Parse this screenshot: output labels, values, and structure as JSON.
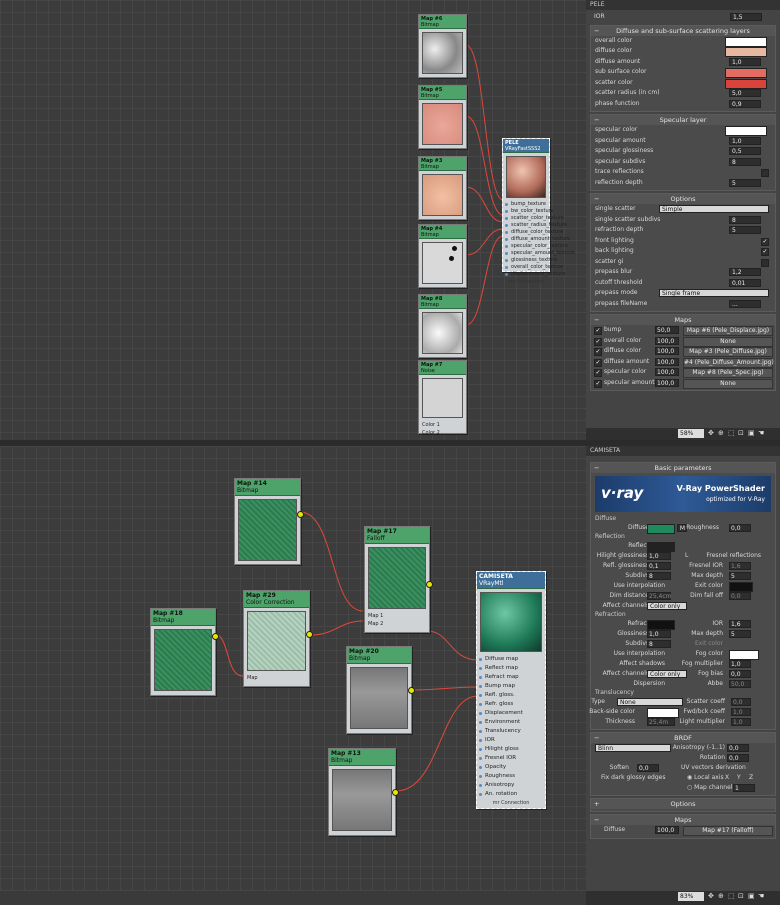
{
  "top_nodes": {
    "map6": {
      "title": "Map #6",
      "type": "Bitmap"
    },
    "map5": {
      "title": "Map #5",
      "type": "Bitmap"
    },
    "map3": {
      "title": "Map #3",
      "type": "Bitmap"
    },
    "map4": {
      "title": "Map #4",
      "type": "Bitmap"
    },
    "map8": {
      "title": "Map #8",
      "type": "Bitmap"
    },
    "map7": {
      "title": "Map #7",
      "type": "Noise",
      "slots": [
        "Color 1",
        "Color 2"
      ]
    },
    "pele": {
      "title": "PELE",
      "type": "VRayFastSSS2",
      "inputs": [
        "bump_texture",
        "bw_color_texture",
        "scatter_color_texture",
        "scatter_radius_texture",
        "diffuse_color_texture",
        "diffuse_amount_texture",
        "specular_color_texture",
        "specular_amount_texture",
        "glossiness_texture",
        "overall_color_texture",
        "displacement_texture"
      ],
      "footer": "mr Connection"
    }
  },
  "bottom_nodes": {
    "map14": {
      "title": "Map #14",
      "type": "Bitmap"
    },
    "map17": {
      "title": "Map #17",
      "type": "Falloff",
      "slots": [
        "Map 1",
        "Map 2"
      ]
    },
    "map29": {
      "title": "Map #29",
      "type": "Color Correction",
      "slots": [
        "Map"
      ]
    },
    "map18": {
      "title": "Map #18",
      "type": "Bitmap"
    },
    "map20": {
      "title": "Map #20",
      "type": "Bitmap"
    },
    "map13": {
      "title": "Map #13",
      "type": "Bitmap"
    },
    "camiseta": {
      "title": "CAMISETA",
      "type": "VRayMtl",
      "inputs": [
        "Diffuse map",
        "Reflect map",
        "Refract map",
        "Bump map",
        "Refl. gloss.",
        "Refr. gloss",
        "Displacement",
        "Environment",
        "Translucency",
        "IOR",
        "Hilight gloss",
        "Fresnel IOR",
        "Opacity",
        "Roughness",
        "Anisotropy",
        "An. rotation"
      ],
      "footer": "mr Connection"
    }
  },
  "top_panel": {
    "header": "PELE",
    "ior_label": "IOR",
    "ior_value": "1,5",
    "diffuse_group": {
      "title": "Diffuse and sub-surface scattering layers",
      "rows": [
        {
          "label": "overall color",
          "kind": "color",
          "color": "#ffffff"
        },
        {
          "label": "diffuse color",
          "kind": "color",
          "color": "#e7b8a0"
        },
        {
          "label": "diffuse amount",
          "kind": "value",
          "value": "1,0"
        },
        {
          "label": "sub surface color",
          "kind": "color",
          "color": "#e26b62"
        },
        {
          "label": "scatter color",
          "kind": "color",
          "color": "#d9433c"
        },
        {
          "label": "scatter radius (in cm)",
          "kind": "value",
          "value": "5,0"
        },
        {
          "label": "phase function",
          "kind": "value",
          "value": "0,9"
        }
      ]
    },
    "specular_group": {
      "title": "Specular layer",
      "rows": [
        {
          "label": "specular color",
          "kind": "color",
          "color": "#ffffff"
        },
        {
          "label": "specular amount",
          "kind": "value",
          "value": "1,0"
        },
        {
          "label": "specular glossiness",
          "kind": "value",
          "value": "0,5"
        },
        {
          "label": "specular subdivs",
          "kind": "value",
          "value": "8"
        },
        {
          "label": "trace reflections",
          "kind": "check",
          "checked": ""
        },
        {
          "label": "reflection depth",
          "kind": "value",
          "value": "5"
        }
      ]
    },
    "options_group": {
      "title": "Options",
      "rows": [
        {
          "label": "single scatter",
          "kind": "dropdown",
          "value": "Simple"
        },
        {
          "label": "single scatter subdivs",
          "kind": "value",
          "value": "8"
        },
        {
          "label": "refraction depth",
          "kind": "value",
          "value": "5"
        },
        {
          "label": "front lighting",
          "kind": "check",
          "checked": "✓"
        },
        {
          "label": "back lighting",
          "kind": "check",
          "checked": "✓"
        },
        {
          "label": "scatter gi",
          "kind": "check",
          "checked": ""
        },
        {
          "label": "prepass blur",
          "kind": "value",
          "value": "1,2"
        },
        {
          "label": "cutoff threshold",
          "kind": "value",
          "value": "0,01"
        },
        {
          "label": "prepass mode",
          "kind": "dropdown",
          "value": "Single frame"
        },
        {
          "label": "prepass fileName",
          "kind": "value",
          "value": "..."
        }
      ]
    },
    "maps_group": {
      "title": "Maps",
      "rows": [
        {
          "label": "bump",
          "amount": "50,0",
          "map": "Map #6 (Pele_Displace.jpg)"
        },
        {
          "label": "overall color",
          "amount": "100,0",
          "map": "None"
        },
        {
          "label": "diffuse color",
          "amount": "100,0",
          "map": "Map #3 (Pele_Diffuse.jpg)"
        },
        {
          "label": "diffuse amount",
          "amount": "100,0",
          "map": "#4 (Pele_Diffuse_Amount.jpg)"
        },
        {
          "label": "specular color",
          "amount": "100,0",
          "map": "Map #8 (Pele_Spec.jpg)"
        },
        {
          "label": "specular amount",
          "amount": "100,0",
          "map": "None"
        }
      ]
    },
    "zoom": "58%"
  },
  "bottom_panel": {
    "header": "CAMISETA",
    "basic_title": "Basic parameters",
    "banner": {
      "logo": "v·ray",
      "title": "V-Ray PowerShader",
      "subtitle": "optimized for V-Ray"
    },
    "diffuse": {
      "section": "Diffuse",
      "label": "Diffuse",
      "m": "M",
      "roughness_label": "Roughness",
      "roughness": "0,0",
      "color": "#1f8a5c"
    },
    "reflection": {
      "section": "Reflection",
      "reflect": "Reflect",
      "hilight_glossiness": "Hilight glossiness",
      "hilight_val": "1,0",
      "l": "L",
      "fresnel_reflections": "Fresnel reflections",
      "refl_glossiness": "Refl. glossiness",
      "refl_val": "0,1",
      "fresnel_ior": "Fresnel IOR",
      "fresnel_ior_val": "1,6",
      "subdivs": "Subdivs",
      "subdivs_val": "8",
      "max_depth": "Max depth",
      "max_depth_val": "5",
      "use_interpolation": "Use interpolation",
      "exit_color": "Exit color",
      "dim_distance": "Dim distance",
      "dim_val": "25,4cm",
      "dim_falloff": "Dim fall off",
      "dim_falloff_val": "0,0",
      "affect_channels": "Affect channels",
      "affect_val": "Color only"
    },
    "refraction": {
      "section": "Refraction",
      "refract": "Refract",
      "ior": "IOR",
      "ior_val": "1,6",
      "glossiness": "Glossiness",
      "gloss_val": "1,0",
      "max_depth": "Max depth",
      "max_depth_val": "5",
      "subdivs": "Subdivs",
      "subdivs_val": "8",
      "exit_color": "Exit color",
      "use_interpolation": "Use interpolation",
      "fog_color": "Fog color",
      "affect_shadows": "Affect shadows",
      "fog_multiplier": "Fog multiplier",
      "fog_multiplier_val": "1,0",
      "affect_channels": "Affect channels",
      "affect_val": "Color only",
      "fog_bias": "Fog bias",
      "fog_bias_val": "0,0",
      "dispersion": "Dispersion",
      "abbe": "Abbe",
      "abbe_val": "50,0"
    },
    "translucency": {
      "section": "Translucency",
      "type": "Type",
      "type_val": "None",
      "scatter_coeff": "Scatter coeff",
      "scatter_val": "0,0",
      "backside_color": "Back-side color",
      "fwd_bck": "Fwd/bck coeff",
      "fwd_val": "1,0",
      "thickness": "Thickness",
      "thickness_val": "25,4m",
      "light_multiplier": "Light multiplier",
      "light_val": "1,0"
    },
    "brdf": {
      "title": "BRDF",
      "type": "Blinn",
      "anisotropy": "Anisotropy (-1..1)",
      "anisotropy_val": "0,0",
      "rotation": "Rotation",
      "rotation_val": "0,0",
      "soften": "Soften",
      "soften_val": "0,0",
      "uv_vectors": "UV vectors derivation",
      "fix_dark": "Fix dark glossy edges",
      "local_axis": "Local axis",
      "x": "X",
      "y": "Y",
      "z": "Z",
      "map_channel": "Map channel",
      "map_channel_val": "1"
    },
    "options_title": "Options",
    "maps_title": "Maps",
    "maps_row": {
      "label": "Diffuse",
      "amount": "100,0",
      "map": "Map #17 (Falloff)"
    },
    "zoom": "83%"
  }
}
